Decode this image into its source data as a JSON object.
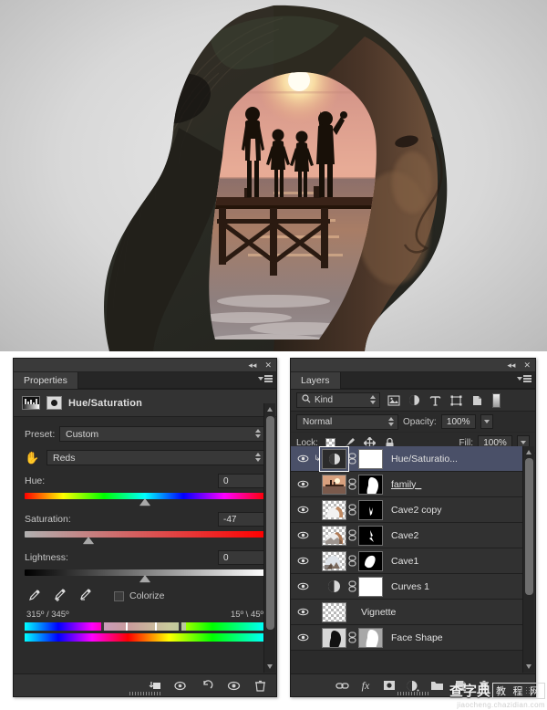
{
  "photo": {
    "alt_description": "Double exposure of woman head silhouette containing a family at sunset on a wooden pier by the sea"
  },
  "properties_panel": {
    "tab_label": "Properties",
    "title": "Hue/Saturation",
    "collapse_icon": "collapse-double-arrow-icon",
    "close_icon": "close-icon",
    "menu_icon": "panel-menu-icon",
    "preset": {
      "label": "Preset:",
      "value": "Custom"
    },
    "channel": {
      "value": "Reds",
      "hand_icon": "on-image-adjust-hand-icon"
    },
    "sliders": [
      {
        "label": "Hue:",
        "value": "0",
        "thumb_pct": 50
      },
      {
        "label": "Saturation:",
        "value": "-47",
        "thumb_pct": 26.5
      },
      {
        "label": "Lightness:",
        "value": "0",
        "thumb_pct": 50
      }
    ],
    "eyedroppers": [
      "eyedropper-icon",
      "eyedropper-add-icon",
      "eyedropper-subtract-icon"
    ],
    "colorize": {
      "label": "Colorize",
      "checked": false
    },
    "hue_range": {
      "left": "315º / 345º",
      "right": "15º \\ 45º"
    },
    "footer_icons": [
      "clip-to-layer-icon",
      "toggle-previous-state-icon",
      "reset-adjustment-icon",
      "toggle-layer-visibility-icon",
      "delete-adjustment-icon"
    ]
  },
  "layers_panel": {
    "tab_label": "Layers",
    "collapse_icon": "collapse-double-arrow-icon",
    "close_icon": "close-icon",
    "menu_icon": "panel-menu-icon",
    "filter": {
      "kind_label": "Kind",
      "search_icon": "search-icon",
      "type_icons": [
        "filter-pixel-layers-icon",
        "filter-adjustment-layers-icon",
        "filter-type-layers-icon",
        "filter-shape-layers-icon",
        "filter-smart-object-icon"
      ],
      "toggle_icon": "filter-enable-toggle"
    },
    "blend_mode": "Normal",
    "opacity": {
      "label": "Opacity:",
      "value": "100%"
    },
    "fill": {
      "label": "Fill:",
      "value": "100%"
    },
    "lock": {
      "label": "Lock:",
      "icons": [
        "lock-transparent-pixels-icon",
        "lock-image-pixels-icon",
        "lock-position-icon",
        "lock-all-icon"
      ]
    },
    "layers": [
      {
        "name": "Hue/Saturatio...",
        "visible": true,
        "selected": true,
        "clipped": true,
        "type": "adjustment",
        "has_mask": true,
        "mask": "white",
        "linked": true,
        "underlined": false
      },
      {
        "name": "family_",
        "visible": true,
        "selected": false,
        "clipped": false,
        "type": "photo-sunset",
        "has_mask": true,
        "mask": "head-silhouette",
        "linked": true,
        "underlined": true
      },
      {
        "name": "Cave2 copy",
        "visible": true,
        "selected": false,
        "clipped": false,
        "type": "photo-cave",
        "has_mask": true,
        "mask": "small-shape",
        "linked": true,
        "underlined": false
      },
      {
        "name": "Cave2",
        "visible": true,
        "selected": false,
        "clipped": false,
        "type": "photo-cave",
        "has_mask": true,
        "mask": "small-shape",
        "linked": true,
        "underlined": false
      },
      {
        "name": "Cave1",
        "visible": true,
        "selected": false,
        "clipped": false,
        "type": "photo-cave",
        "has_mask": true,
        "mask": "blob-shape",
        "linked": true,
        "underlined": false
      },
      {
        "name": "Curves 1",
        "visible": true,
        "selected": false,
        "clipped": false,
        "type": "adjustment",
        "has_mask": true,
        "mask": "white",
        "linked": true,
        "underlined": false
      },
      {
        "name": "Vignette",
        "visible": true,
        "selected": false,
        "clipped": false,
        "type": "transparent",
        "has_mask": false,
        "mask": "",
        "linked": false,
        "underlined": false
      },
      {
        "name": "Face Shape",
        "visible": true,
        "selected": false,
        "clipped": false,
        "type": "photo-face",
        "has_mask": true,
        "mask": "head-white",
        "linked": true,
        "underlined": false
      }
    ],
    "footer_icons": [
      "link-layers-icon",
      "layer-style-fx-icon",
      "add-layer-mask-icon",
      "new-adjustment-layer-icon",
      "new-group-icon",
      "new-layer-icon",
      "delete-layer-icon"
    ]
  },
  "watermark": {
    "chars": "查字典",
    "boxed": "教 程 网",
    "url": "jiaocheng.chazidian.com"
  },
  "colors": {
    "panel_bg": "#2b2b2b",
    "panel_header": "#3a3a3a",
    "selected_layer": "#4a5068",
    "text": "#c8c8c8"
  }
}
